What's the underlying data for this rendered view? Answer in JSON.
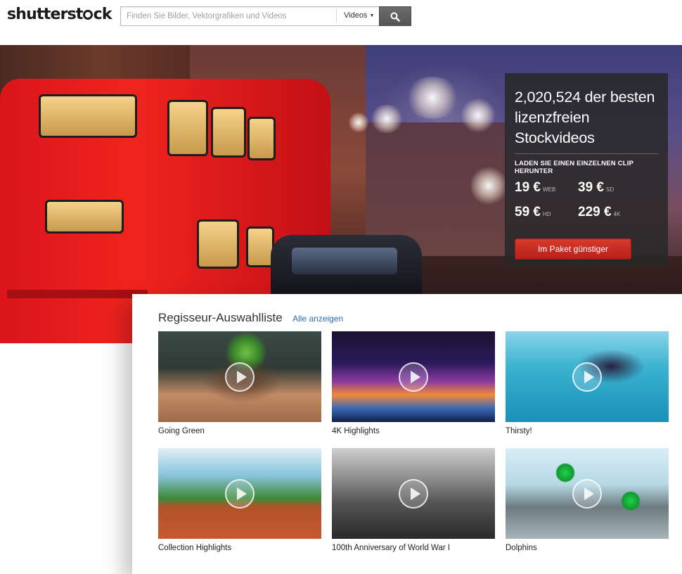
{
  "header": {
    "logo_text_before": "shutterst",
    "logo_text_after": "ck",
    "search": {
      "placeholder": "Finden Sie Bilder, Vektorgrafiken und Videos",
      "value": "",
      "type_selected": "Videos"
    }
  },
  "hero": {
    "title": "2,020,524 der besten lizenzfreien Stockvideos",
    "subtitle": "LADEN SIE EINEN EINZELNEN CLIP HERUNTER",
    "prices": [
      {
        "amount": "19 €",
        "tier": "WEB"
      },
      {
        "amount": "39 €",
        "tier": "SD"
      },
      {
        "amount": "59 €",
        "tier": "HD"
      },
      {
        "amount": "229 €",
        "tier": "4K"
      }
    ],
    "cta_label": "Im Paket günstiger"
  },
  "picks": {
    "title": "Regisseur-Auswahlliste",
    "link": "Alle anzeigen",
    "items": [
      {
        "label": "Going Green"
      },
      {
        "label": "4K Highlights"
      },
      {
        "label": "Thirsty!"
      },
      {
        "label": "Collection Highlights"
      },
      {
        "label": "100th Anniversary of World War I"
      },
      {
        "label": "Dolphins"
      }
    ]
  },
  "colors": {
    "cta": "#c92b22",
    "link": "#2b6db5",
    "search_button": "#5f5f5f"
  }
}
